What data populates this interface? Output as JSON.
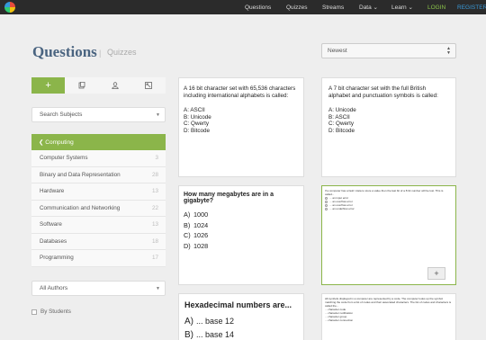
{
  "nav": {
    "items": [
      "Questions",
      "Quizzes",
      "Streams",
      "Data",
      "Learn"
    ],
    "login": "LOGIN",
    "register": "REGISTER"
  },
  "header": {
    "title": "Questions",
    "separator": "|",
    "subtitle": "Quizzes"
  },
  "sort": {
    "value": "Newest"
  },
  "sidebar": {
    "subject_select": "Search Subjects",
    "category_header": "Computing",
    "categories": [
      {
        "label": "Computer Systems",
        "count": "3"
      },
      {
        "label": "Binary and Data Representation",
        "count": "28"
      },
      {
        "label": "Hardware",
        "count": "13"
      },
      {
        "label": "Communication and Networking",
        "count": "22"
      },
      {
        "label": "Software",
        "count": "13"
      },
      {
        "label": "Databases",
        "count": "18"
      },
      {
        "label": "Programming",
        "count": "17"
      }
    ],
    "author_select": "All Authors",
    "by_students": "By Students"
  },
  "cards": {
    "c1": {
      "question": "A 16 bit character set with 65,536 characters including international alphabets is called:",
      "options": [
        "A: ASCII",
        "B: Unicode",
        "C: Qwerty",
        "D: Bitcode"
      ]
    },
    "c2": {
      "question": "A 7 bit character set with the full British alphabet and punctuation symbols is called:",
      "options": [
        "A: Unicode",
        "B: ASCII",
        "C: Qwerty",
        "D: Bitcode"
      ]
    },
    "c3": {
      "question": "How many megabytes are in a gigabyte?",
      "options": [
        {
          "letter": "A)",
          "text": "1000"
        },
        {
          "letter": "B)",
          "text": "1024"
        },
        {
          "letter": "C)",
          "text": "1026"
        },
        {
          "letter": "D)",
          "text": "1028"
        }
      ]
    },
    "c4": {
      "question": "If a computer has a fault / data to store a value then the last bit of a 8 bit number will be lost. This is called...",
      "options": [
        "... an input error",
        "... an overflow error",
        "... an overflow error",
        "... an underflow error"
      ],
      "add_label": "+"
    },
    "c5": {
      "question": "Hexadecimal numbers are...",
      "options": [
        {
          "letter": "A)",
          "text": "... base 12"
        },
        {
          "letter": "B)",
          "text": "... base 14"
        }
      ]
    },
    "c6": {
      "question": "All symbols displayed in a computer are represented by a code. The computer looks up the symbol matching the code from a list of codes and their associated characters. The list of codes and characters is called the...",
      "options": [
        "... character code",
        "... character notification",
        "... character group",
        "... character connection"
      ]
    }
  },
  "colors": {
    "accent": "#8bb54a",
    "title": "#4a6480",
    "topbar": "#2b2b2b"
  }
}
